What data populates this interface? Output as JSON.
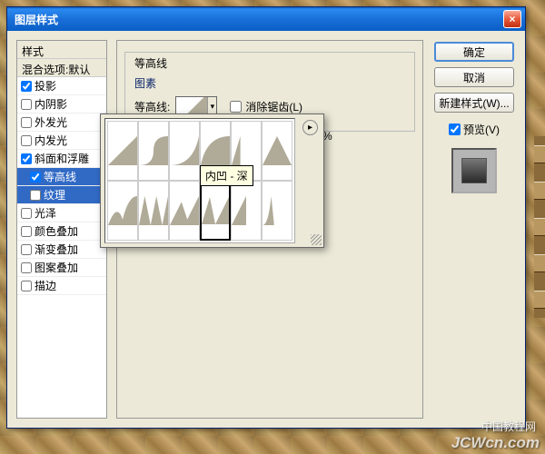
{
  "dialog": {
    "title": "图层样式",
    "close_icon": "×"
  },
  "styles_panel": {
    "header": "样式",
    "blend_options": "混合选项:默认",
    "items": [
      {
        "label": "投影",
        "checked": true,
        "selected": false,
        "child": false
      },
      {
        "label": "内阴影",
        "checked": false,
        "selected": false,
        "child": false
      },
      {
        "label": "外发光",
        "checked": false,
        "selected": false,
        "child": false
      },
      {
        "label": "内发光",
        "checked": false,
        "selected": false,
        "child": false
      },
      {
        "label": "斜面和浮雕",
        "checked": true,
        "selected": false,
        "child": false
      },
      {
        "label": "等高线",
        "checked": true,
        "selected": true,
        "child": true
      },
      {
        "label": "纹理",
        "checked": false,
        "selected": true,
        "child": true
      },
      {
        "label": "光泽",
        "checked": false,
        "selected": false,
        "child": false
      },
      {
        "label": "颜色叠加",
        "checked": false,
        "selected": false,
        "child": false
      },
      {
        "label": "渐变叠加",
        "checked": false,
        "selected": false,
        "child": false
      },
      {
        "label": "图案叠加",
        "checked": false,
        "selected": false,
        "child": false
      },
      {
        "label": "描边",
        "checked": false,
        "selected": false,
        "child": false
      }
    ]
  },
  "contour_section": {
    "fieldset_title": "等高线",
    "sub_title": "图素",
    "contour_label": "等高线:",
    "antialiased": "消除锯齿(L)",
    "antialiased_checked": false,
    "pct_symbol": "%"
  },
  "contour_picker": {
    "tooltip": "内凹 - 深"
  },
  "buttons": {
    "ok": "确定",
    "cancel": "取消",
    "new_style": "新建样式(W)...",
    "preview_label": "预览(V)",
    "preview_checked": true
  },
  "watermark": {
    "cn": "中国教程网",
    "url": "JCWcn.com"
  }
}
